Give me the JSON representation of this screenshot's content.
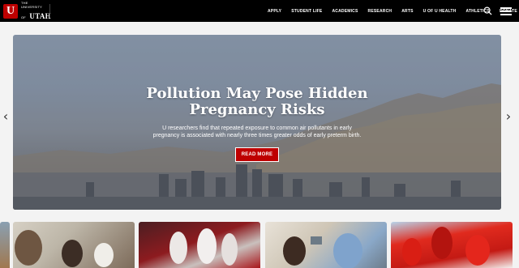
{
  "brand": {
    "line1": "THE",
    "line2": "UNIVERSITY",
    "line3": "OF",
    "line4": "UTAH"
  },
  "nav": {
    "items": [
      {
        "label": "APPLY"
      },
      {
        "label": "STUDENT LIFE"
      },
      {
        "label": "ACADEMICS"
      },
      {
        "label": "RESEARCH"
      },
      {
        "label": "ARTS"
      },
      {
        "label": "U OF U HEALTH"
      },
      {
        "label": "ATHLETICS"
      },
      {
        "label": "DONATE"
      }
    ]
  },
  "carousel": {
    "prev_arrow": "‹",
    "next_arrow": "›"
  },
  "hero": {
    "title_line1": "Pollution May Pose Hidden",
    "title_line2": "Pregnancy Risks",
    "subtitle": "U researchers find that repeated exposure to common air pollutants in early pregnancy is associated with nearly three times greater odds of early preterm birth.",
    "cta": "READ MORE"
  },
  "colors": {
    "header_bg": "#000000",
    "accent_red": "#be0000",
    "page_bg": "#f3f3f3"
  },
  "icons": {
    "search": "search-icon",
    "menu": "hamburger-menu-icon",
    "logo": "block-u-logo-icon"
  }
}
